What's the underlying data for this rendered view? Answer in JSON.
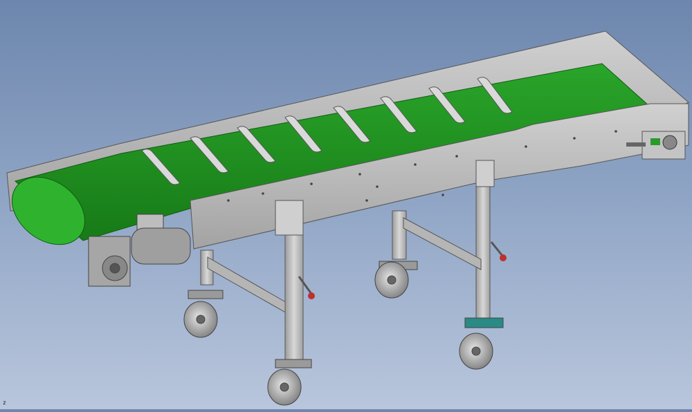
{
  "viewport": {
    "background_top": "#6d86ad",
    "background_bottom": "#b9c6dc",
    "axis_indicator": "z"
  },
  "model": {
    "type": "inclined belt conveyor on mobile stand",
    "belt_color": "#1f8f1f",
    "frame_color": "#b8b8b8",
    "cleat_count": 8,
    "caster_count": 4,
    "handle_knob_color": "#c0302a",
    "brake_pad_color": "#2a8a86"
  }
}
